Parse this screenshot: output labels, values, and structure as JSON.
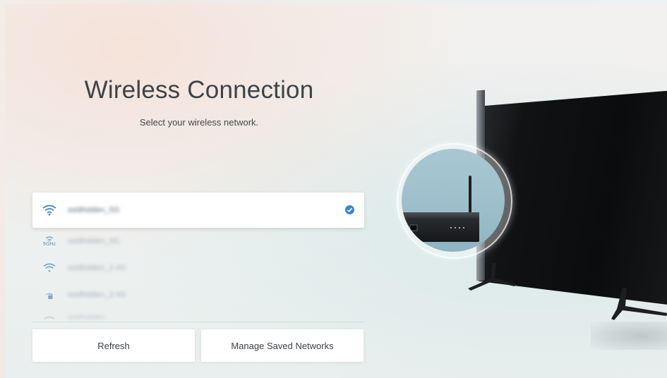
{
  "page": {
    "title": "Wireless Connection",
    "subtitle": "Select your wireless network."
  },
  "networks": [
    {
      "name": "ssidhidden_5G",
      "icon": "wifi-icon",
      "selected": true,
      "connected": true
    },
    {
      "name": "ssidhidden_5G",
      "icon": "wifi-5ghz-icon",
      "band_label": "5GHz",
      "selected": false
    },
    {
      "name": "ssidhidden_2.4G",
      "icon": "wifi-icon",
      "selected": false
    },
    {
      "name": "ssidhidden_2.4G",
      "icon": "wifi-locked-icon",
      "selected": false
    },
    {
      "name": "ssidhidden",
      "icon": "wifi-icon",
      "selected": false
    }
  ],
  "buttons": {
    "refresh": "Refresh",
    "manage": "Manage Saved Networks"
  },
  "colors": {
    "accent": "#3a86c9",
    "text": "#3d4349"
  }
}
